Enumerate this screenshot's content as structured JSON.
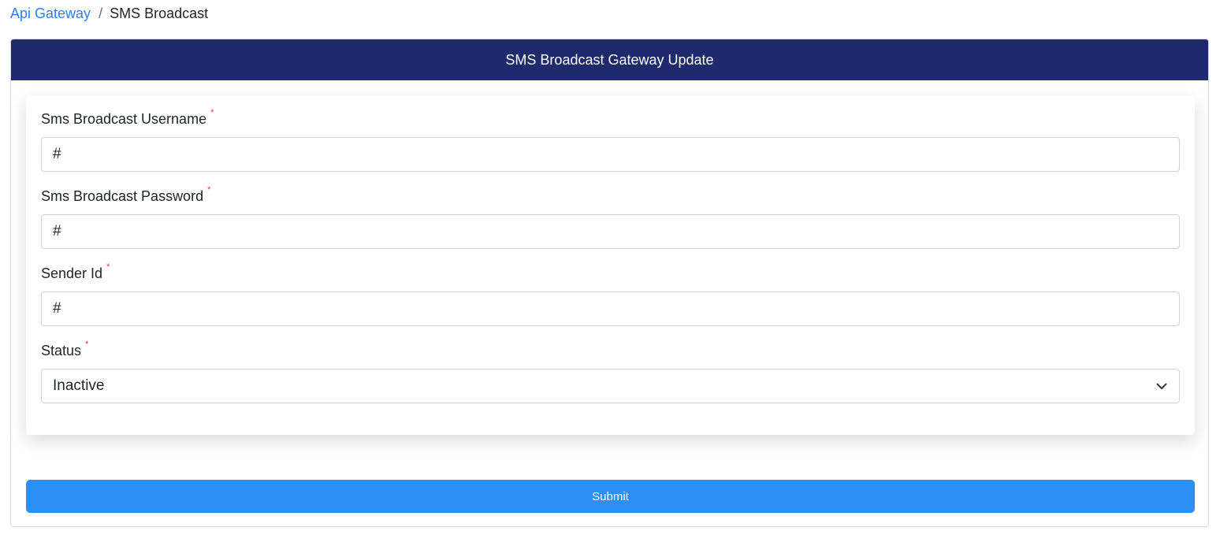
{
  "breadcrumb": {
    "parent": "Api Gateway",
    "separator": "/",
    "current": "SMS Broadcast"
  },
  "card": {
    "title": "SMS Broadcast Gateway Update",
    "header_color": "#1f2a6d"
  },
  "form": {
    "username": {
      "label": "Sms Broadcast Username",
      "required_mark": "*",
      "value": "#"
    },
    "password": {
      "label": "Sms Broadcast Password",
      "required_mark": "*",
      "value": "#"
    },
    "sender_id": {
      "label": "Sender Id",
      "required_mark": "*",
      "value": "#"
    },
    "status": {
      "label": "Status",
      "required_mark": "*",
      "selected": "Inactive",
      "icon": "chevron-down-icon"
    }
  },
  "submit": {
    "label": "Submit",
    "color": "#2b8ff7"
  }
}
